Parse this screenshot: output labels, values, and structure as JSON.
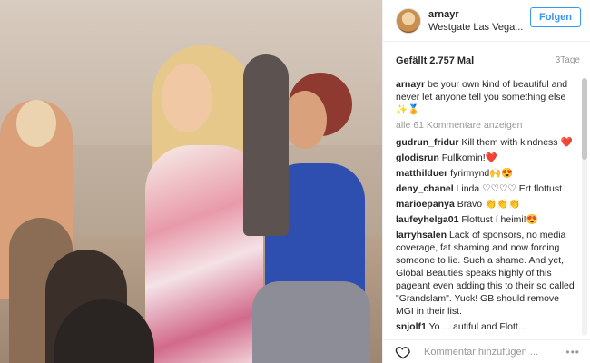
{
  "post": {
    "username": "arnayr",
    "location": "Westgate Las Vega...",
    "follow_label": "Folgen",
    "likes": "Gefällt 2.757 Mal",
    "time": "3Tage",
    "caption": "be your own kind of beautiful and never let anyone tell you something else ✨🏅",
    "load_more": "alle 61 Kommentare anzeigen"
  },
  "comments": [
    {
      "user": "gudrun_fridur",
      "text": "Kill them with kindness ❤️"
    },
    {
      "user": "glodisrun",
      "text": "Fullkomin!❤️"
    },
    {
      "user": "matthilduer",
      "text": "fyrirmynd🙌😍"
    },
    {
      "user": "deny_chanel",
      "text": "Linda ♡♡♡♡ Ert flottust"
    },
    {
      "user": "marioepanya",
      "text": "Bravo 👏👏👏"
    },
    {
      "user": "laufeyhelga01",
      "text": "Flottust í heimi!😍"
    },
    {
      "user": "larryhsalen",
      "text": "Lack of sponsors, no media coverage, fat shaming and now forcing someone to lie. Such a shame. And yet, Global Beauties speaks highly of this pageant even adding this to their so called \"Grandslam\". Yuck! GB should remove MGI in their list."
    },
    {
      "user": "snjolf1",
      "text": "Yo ... autiful and Flott..."
    }
  ],
  "footer": {
    "comment_placeholder": "Kommentar hinzufügen ...",
    "more": "•••"
  },
  "icons": {
    "heart": "heart-icon",
    "avatar": "avatar",
    "more": "more-options-icon"
  },
  "colors": {
    "accent": "#3897f0",
    "heart_red": "#ed4956",
    "muted": "#999999"
  }
}
